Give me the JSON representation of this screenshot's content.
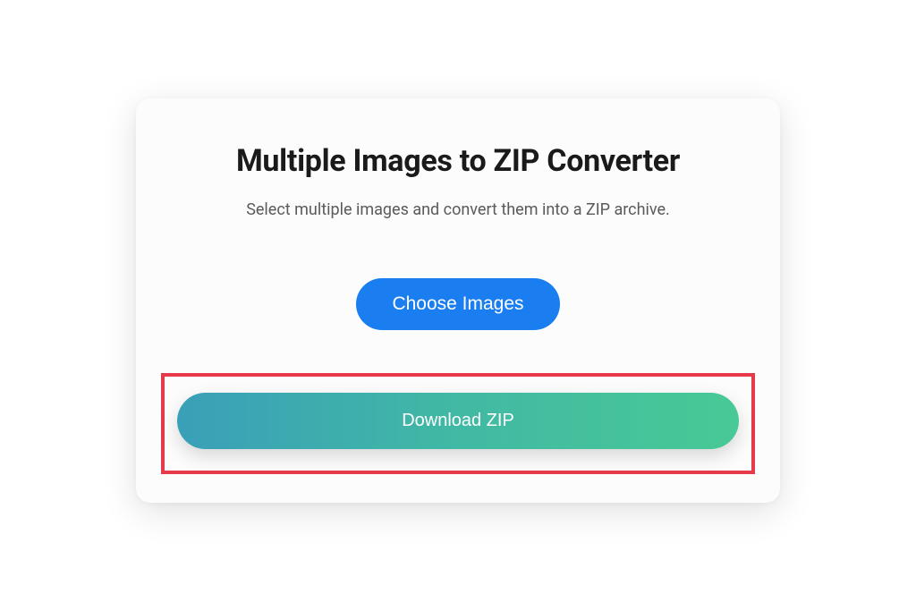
{
  "card": {
    "title": "Multiple Images to ZIP Converter",
    "subtitle": "Select multiple images and convert them into a ZIP archive.",
    "choose_label": "Choose Images",
    "download_label": "Download ZIP"
  },
  "colors": {
    "primary_blue": "#1a7df0",
    "gradient_start": "#3a9fb8",
    "gradient_end": "#48c995",
    "highlight_border": "#e63a4a"
  }
}
